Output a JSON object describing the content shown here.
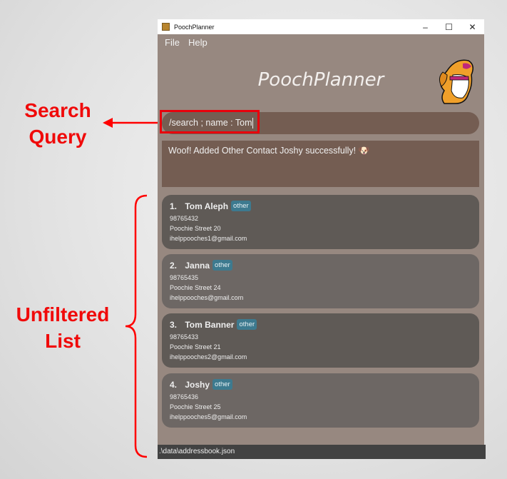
{
  "window": {
    "title": "PoochPlanner",
    "controls": [
      "–",
      "☐",
      "✕"
    ]
  },
  "menu": [
    "File",
    "Help"
  ],
  "header": {
    "title": "PoochPlanner"
  },
  "command_box": {
    "value": "/search ; name : Tom"
  },
  "result_display": {
    "text": "Woof! Added Other Contact Joshy successfully! 🐶"
  },
  "contacts": [
    {
      "index": "1.",
      "name": "Tom Aleph",
      "tag": "other",
      "phone": "98765432",
      "address": "Poochie Street 20",
      "email": "ihelppooches1@gmail.com"
    },
    {
      "index": "2.",
      "name": "Janna",
      "tag": "other",
      "phone": "98765435",
      "address": "Poochie Street 24",
      "email": "ihelppooches@gmail.com"
    },
    {
      "index": "3.",
      "name": "Tom Banner",
      "tag": "other",
      "phone": "98765433",
      "address": "Poochie Street 21",
      "email": "ihelppooches2@gmail.com"
    },
    {
      "index": "4.",
      "name": "Joshy",
      "tag": "other",
      "phone": "98765436",
      "address": "Poochie Street 25",
      "email": "ihelppooches5@gmail.com"
    }
  ],
  "status_bar": {
    "path": ".\\data\\addressbook.json"
  },
  "annotations": {
    "search": "Search\nQuery",
    "list": "Unfiltered\nList"
  }
}
